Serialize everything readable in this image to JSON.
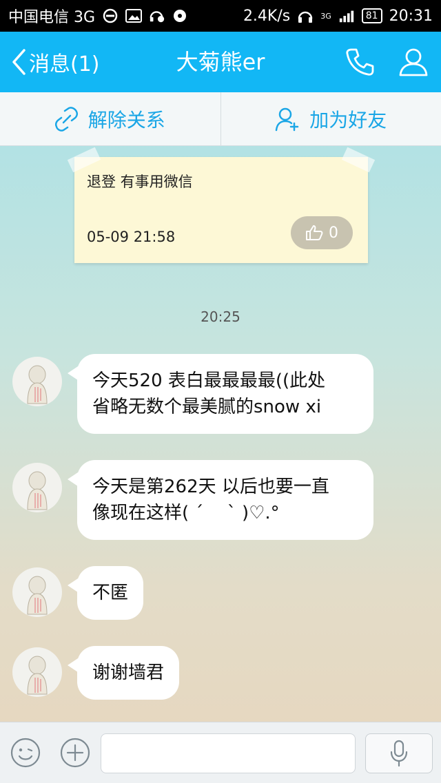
{
  "status_bar": {
    "carrier": "中国电信 3G",
    "speed": "2.4K/s",
    "network": "3G",
    "battery": "81",
    "time": "20:31"
  },
  "header": {
    "back_label": "消息(1)",
    "title": "大菊熊er"
  },
  "actions": {
    "unfriend_label": "解除关系",
    "add_friend_label": "加为好友"
  },
  "note": {
    "text": "退登 有事用微信",
    "time": "05-09 21:58",
    "likes": "0"
  },
  "chat": {
    "timestamp": "20:25",
    "messages": [
      {
        "lines": [
          "今天520 表白最最最最((此处",
          "省略无数个最美腻的snow xi"
        ]
      },
      {
        "lines": [
          "今天是第262天 以后也要一直",
          "像现在这样( ´　 ` )♡.°"
        ]
      },
      {
        "lines": [
          "不匿"
        ]
      },
      {
        "lines": [
          "谢谢墙君"
        ]
      }
    ]
  },
  "colors": {
    "accent": "#12b7f5",
    "action_text": "#1aa6e6"
  }
}
